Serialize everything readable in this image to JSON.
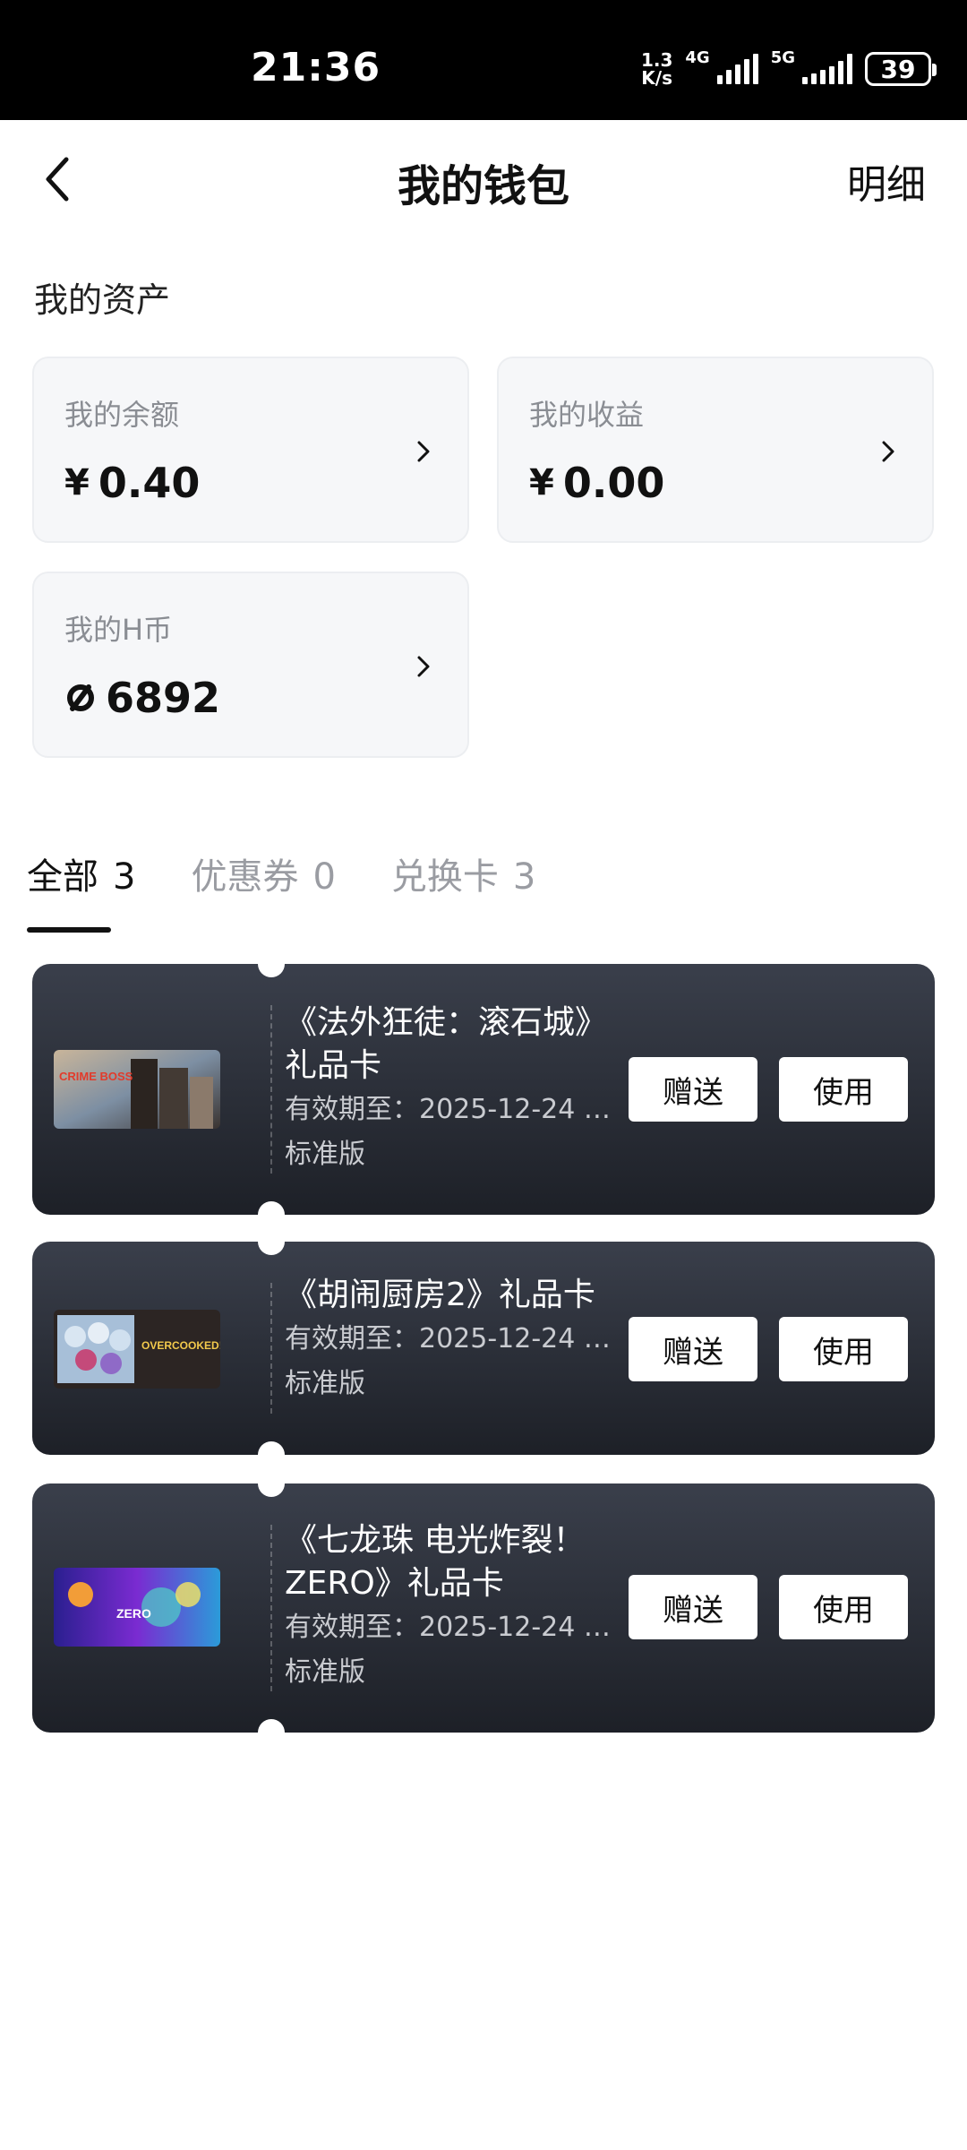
{
  "status_bar": {
    "time": "21:36",
    "net_speed_value": "1.3",
    "net_speed_unit": "K/s",
    "net_4g": "4G",
    "net_5g": "5G",
    "battery": "39"
  },
  "header": {
    "title": "我的钱包",
    "detail": "明细"
  },
  "assets": {
    "section_title": "我的资产",
    "balance": {
      "label": "我的余额",
      "prefix": "¥",
      "value": "0.40"
    },
    "earnings": {
      "label": "我的收益",
      "prefix": "¥",
      "value": "0.00"
    },
    "hcoin": {
      "label": "我的H币",
      "value": "6892"
    }
  },
  "tabs": [
    {
      "label": "全部",
      "count": "3",
      "active": true
    },
    {
      "label": "优惠券",
      "count": "0",
      "active": false
    },
    {
      "label": "兑换卡",
      "count": "3",
      "active": false
    }
  ],
  "cards": [
    {
      "title_line1": "《法外狂徒：滚石城》",
      "title_line2": "礼品卡",
      "expiry": "有效期至：2025-12-24 1...",
      "edition": "标准版",
      "thumb_text": "CRIME BOSS",
      "gift_label": "赠送",
      "use_label": "使用"
    },
    {
      "title_line1": "《胡闹厨房2》礼品卡",
      "expiry": "有效期至：2025-12-24 1...",
      "edition": "标准版",
      "thumb_text": "OVERCOOKED! 2",
      "gift_label": "赠送",
      "use_label": "使用"
    },
    {
      "title_line1": "《七龙珠 电光炸裂！",
      "title_line2": "ZERO》礼品卡",
      "expiry": "有效期至：2025-12-24 1...",
      "edition": "标准版",
      "thumb_text": "ZERO",
      "gift_label": "赠送",
      "use_label": "使用"
    }
  ]
}
